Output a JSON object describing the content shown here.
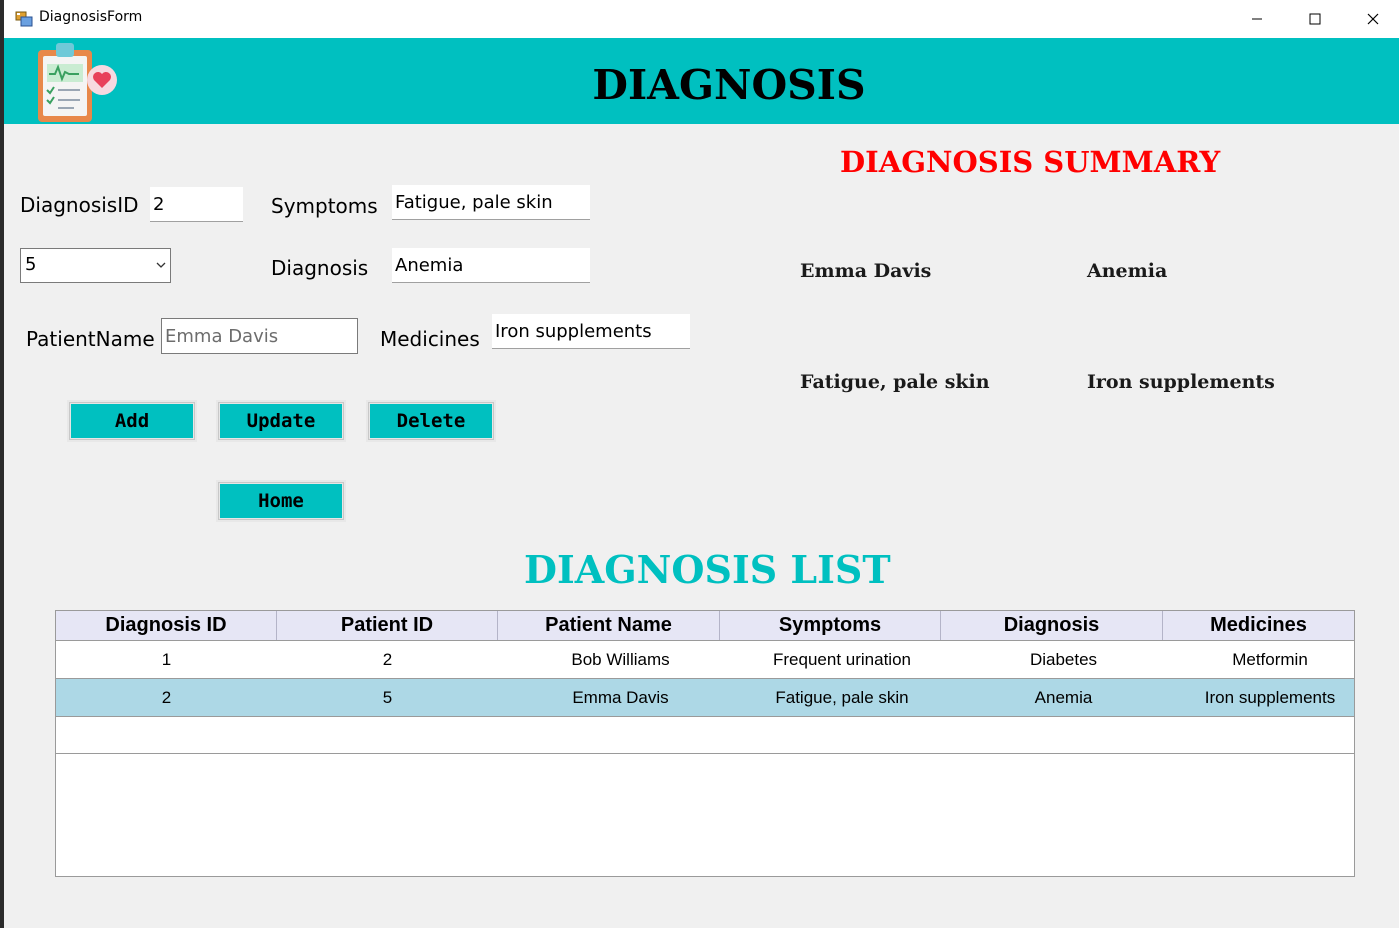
{
  "window": {
    "title": "DiagnosisForm"
  },
  "header": {
    "title": "DIAGNOSIS"
  },
  "form": {
    "diagnosis_id_label": "DiagnosisID",
    "diagnosis_id_value": "2",
    "patient_id_value": "5",
    "patient_name_label": "PatientName",
    "patient_name_value": "Emma Davis",
    "symptoms_label": "Symptoms",
    "symptoms_value": "Fatigue, pale skin",
    "diagnosis_label": "Diagnosis",
    "diagnosis_value": "Anemia",
    "medicines_label": "Medicines",
    "medicines_value": "Iron supplements"
  },
  "buttons": {
    "add": "Add",
    "update": "Update",
    "delete": "Delete",
    "home": "Home"
  },
  "summary": {
    "title": "DIAGNOSIS SUMMARY",
    "patient_name": "Emma Davis",
    "diagnosis": "Anemia",
    "symptoms": "Fatigue, pale skin",
    "medicines": "Iron supplements"
  },
  "list": {
    "title": "DIAGNOSIS LIST",
    "columns": [
      "Diagnosis ID",
      "Patient ID",
      "Patient Name",
      "Symptoms",
      "Diagnosis",
      "Medicines"
    ],
    "rows": [
      [
        "1",
        "2",
        "Bob Williams",
        "Frequent urination",
        "Diabetes",
        "Metformin"
      ],
      [
        "2",
        "5",
        "Emma Davis",
        "Fatigue, pale skin",
        "Anemia",
        "Iron supplements"
      ]
    ],
    "selected_row": 1
  },
  "colors": {
    "accent": "#00c0c0",
    "summary_title": "#ff0000",
    "selected_row": "#add8e6",
    "header_row": "#e6e6f5"
  },
  "icons": {
    "app": "form-icon",
    "logo": "clipboard-heart-icon"
  }
}
